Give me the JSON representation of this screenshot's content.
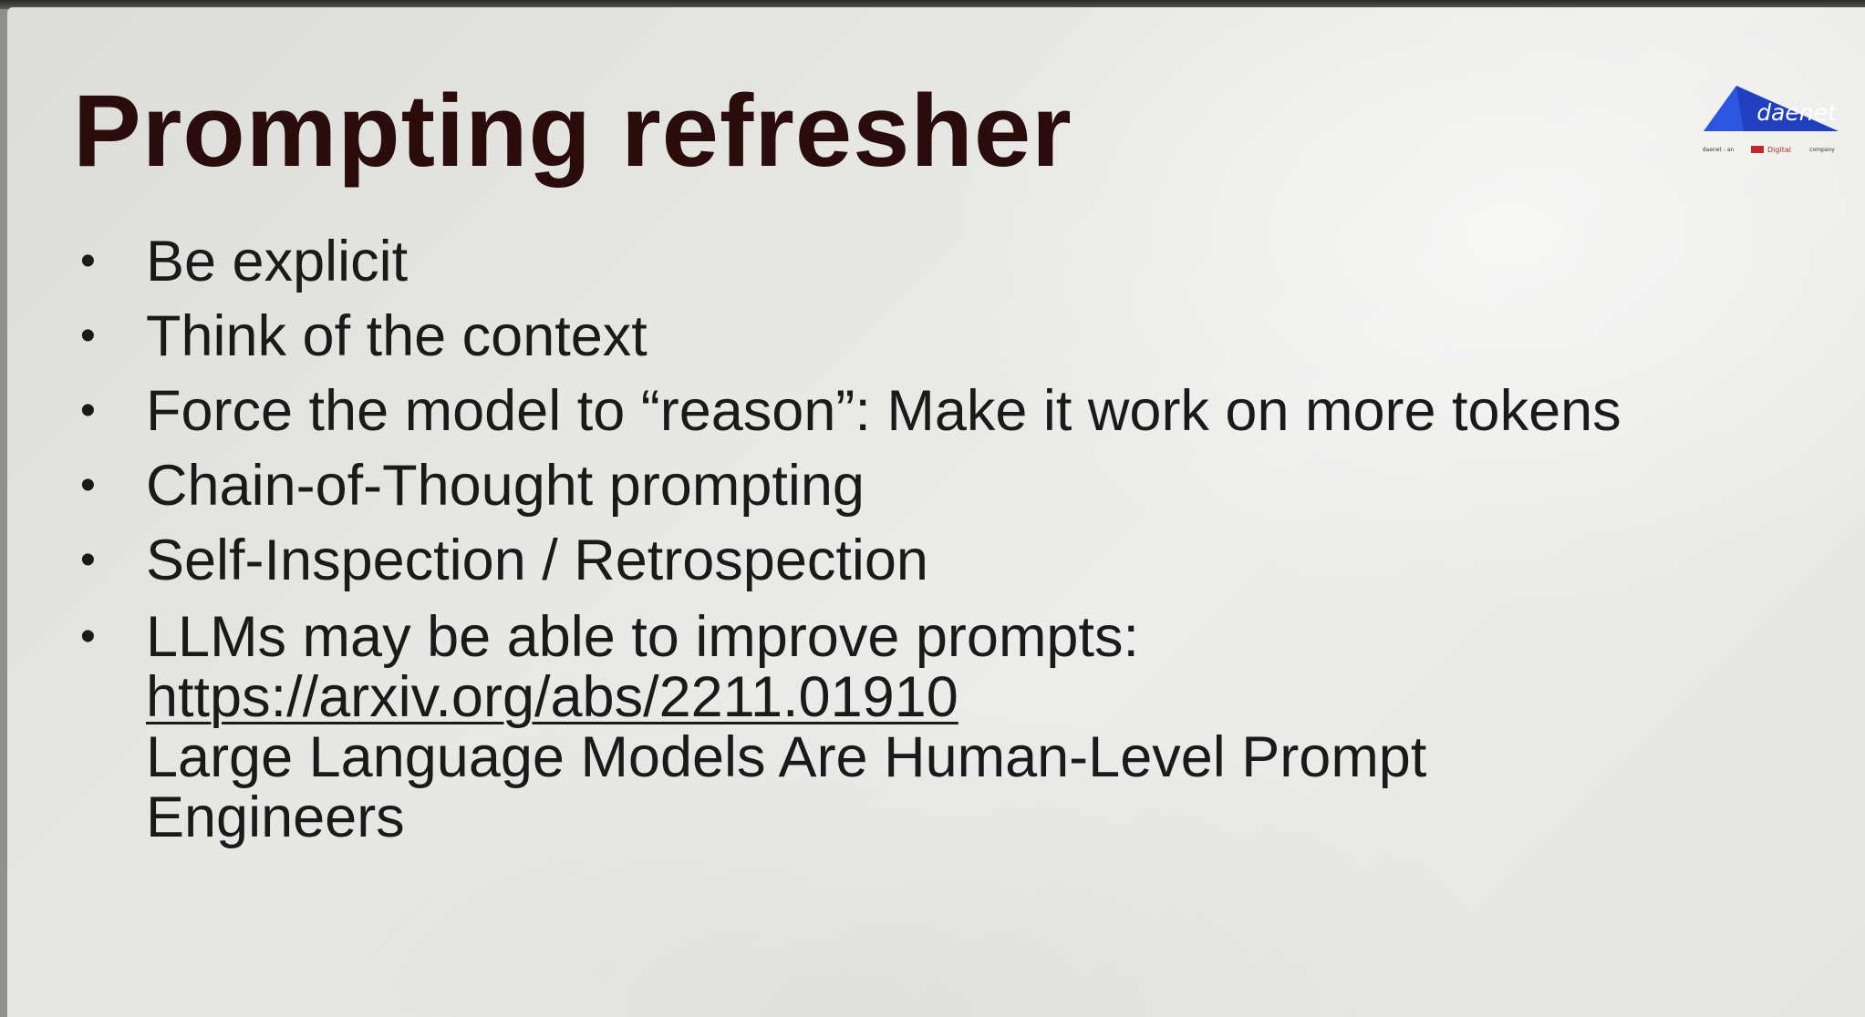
{
  "slide": {
    "title": "Prompting refresher",
    "bullets": [
      "Be explicit",
      "Think of the context",
      "Force the model to “reason”: Make it work on more tokens",
      "Chain-of-Thought prompting",
      "Self-Inspection / Retrospection"
    ],
    "last_bullet": {
      "text": "LLMs may be able to improve prompts:",
      "link": "https://arxiv.org/abs/2211.01910",
      "paper_title_line1": "Large Language Models Are Human-Level Prompt",
      "paper_title_line2": "Engineers"
    }
  },
  "logo": {
    "wordmark": "daenet",
    "tagline_left": "daenet - an",
    "tagline_badge": "Digital",
    "tagline_right": "company",
    "colors": {
      "blue": "#1f3fbf",
      "red": "#c0282c"
    }
  }
}
